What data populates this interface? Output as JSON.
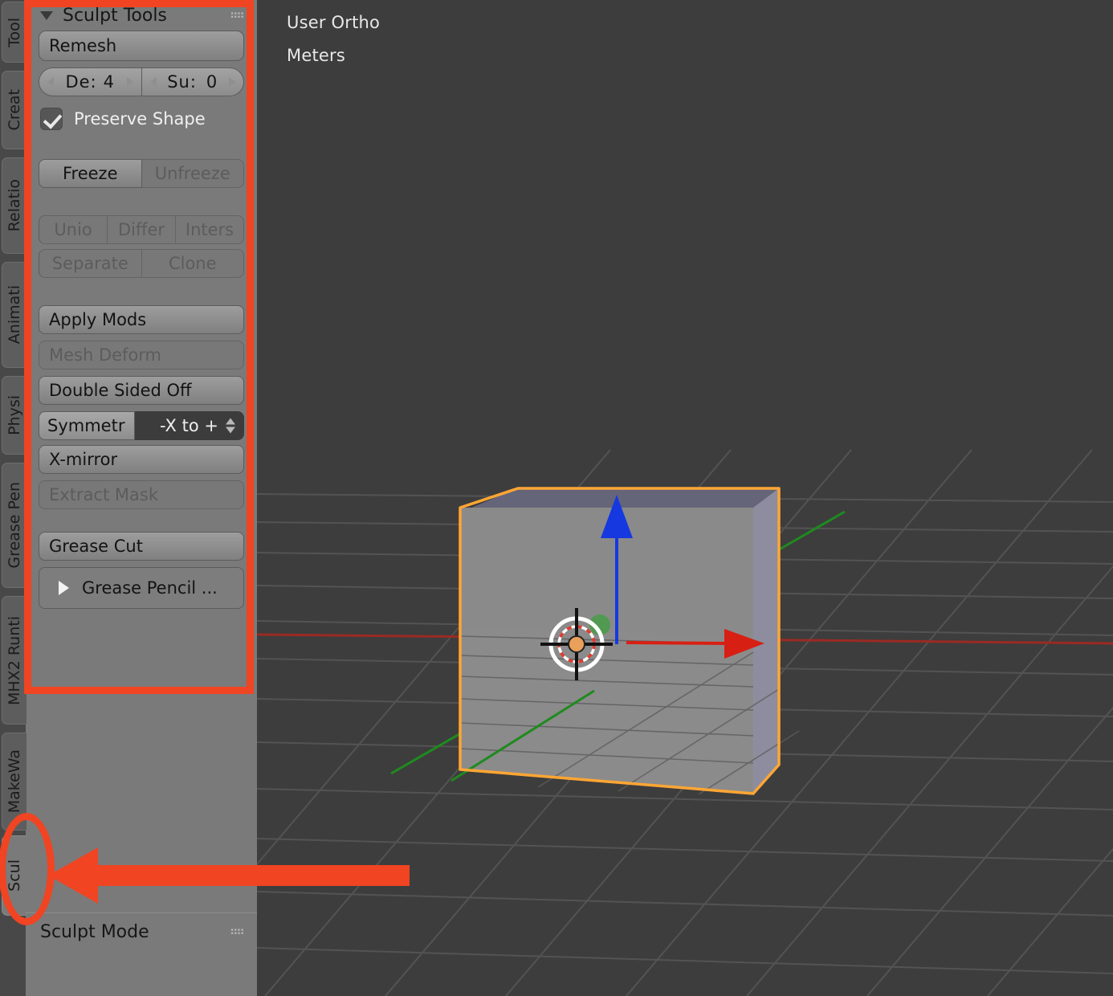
{
  "viewport": {
    "view_label": "User Ortho",
    "units_label": "Meters",
    "background_color": "#3d3d3d",
    "grid_color": "#4f4f4f",
    "x_axis_color": "#9b2a23",
    "y_axis_color": "#1f8a1f",
    "object_outline_color": "#ffa634"
  },
  "tabs": [
    {
      "label": "Tool",
      "active": false
    },
    {
      "label": "Creat",
      "active": false
    },
    {
      "label": "Relatio",
      "active": false
    },
    {
      "label": "Animati",
      "active": false
    },
    {
      "label": "Physi",
      "active": false
    },
    {
      "label": "Grease Pen",
      "active": false
    },
    {
      "label": "MHX2 Runti",
      "active": false
    },
    {
      "label": "MakeWa",
      "active": false
    },
    {
      "label": "Scul",
      "active": true
    }
  ],
  "panel": {
    "title": "Sculpt Tools",
    "remesh_label": "Remesh",
    "depth": {
      "label": "De:",
      "value": "4"
    },
    "subdiv": {
      "label": "Su:",
      "value": "0"
    },
    "preserve_shape": {
      "label": "Preserve Shape",
      "checked": true
    },
    "freeze_label": "Freeze",
    "unfreeze_label": "Unfreeze",
    "union_label": "Unio",
    "difference_label": "Differ",
    "intersect_label": "Inters",
    "separate_label": "Separate",
    "clone_label": "Clone",
    "apply_mods_label": "Apply Mods",
    "mesh_deform_label": "Mesh Deform",
    "double_sided_label": "Double Sided Off",
    "symmetry_label": "Symmetr",
    "symmetry_value": "-X to +",
    "x_mirror_label": "X-mirror",
    "extract_mask_label": "Extract Mask",
    "grease_cut_label": "Grease Cut",
    "grease_pencil_label": "Grease Pencil ..."
  },
  "mode_panel": {
    "title": "Sculpt Mode"
  },
  "annotations": {
    "highlight_color": "#f04423",
    "rect_target": "Sculpt Tools panel",
    "ellipse_target": "Scul tab",
    "arrow_direction": "left"
  }
}
